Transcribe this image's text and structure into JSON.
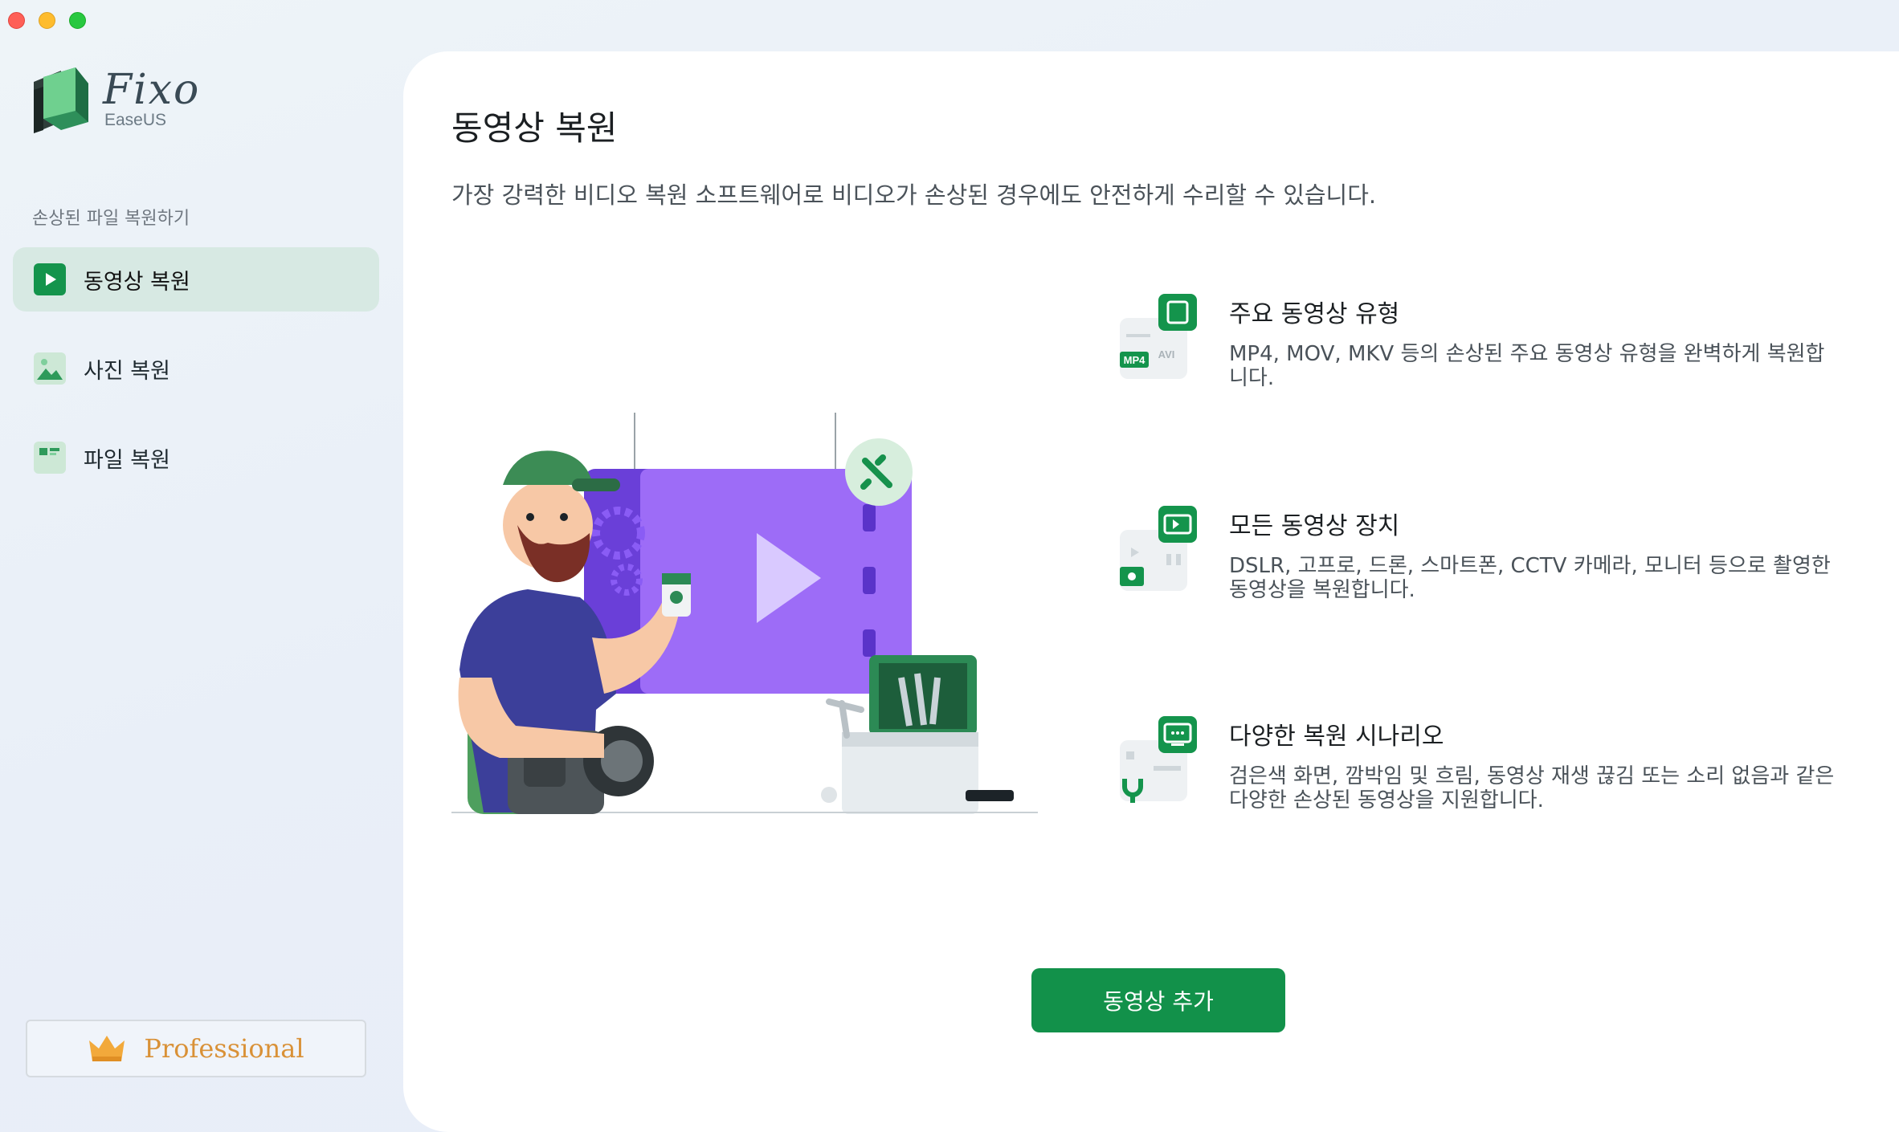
{
  "window": {
    "controls": [
      "close",
      "minimize",
      "zoom"
    ]
  },
  "sidebar": {
    "logo_title": "Fixo",
    "logo_subtitle": "EaseUS",
    "section_label": "손상된 파일 복원하기",
    "items": [
      {
        "label": "동영상 복원",
        "icon": "video-play-icon",
        "active": true
      },
      {
        "label": "사진 복원",
        "icon": "photo-icon",
        "active": false
      },
      {
        "label": "파일 복원",
        "icon": "file-icon",
        "active": false
      }
    ],
    "pro_button": {
      "label": "Professional",
      "icon": "crown-icon"
    }
  },
  "main": {
    "title": "동영상 복원",
    "description": "가장 강력한 비디오 복원 소프트웨어로 비디오가 손상된 경우에도 안전하게 수리할 수 있습니다.",
    "features": [
      {
        "title": "주요 동영상  유형",
        "description": "MP4, MOV, MKV 등의 손상된 주요 동영상  유형을 완벽하게 복원합니다.",
        "icon": "video-format-icon",
        "badges": [
          "MP4",
          "AVI"
        ]
      },
      {
        "title": "모든 동영상 장치",
        "description": "DSLR, 고프로, 드론, 스마트폰, CCTV 카메라, 모니터 등으로 촬영한 동영상을 복원합니다.",
        "icon": "video-device-icon"
      },
      {
        "title": "다양한 복원 시나리오",
        "description": "검은색 화면, 깜박임 및 흐림, 동영상 재생 끊김 또는 소리 없음과 같은 다양한 손상된 동영상을 지원합니다.",
        "icon": "repair-scenario-icon"
      }
    ],
    "add_button_label": "동영상 추가"
  },
  "colors": {
    "accent": "#12914a",
    "sidebar_active": "#d7e9e3",
    "pro_text": "#d99137",
    "illustration_purple": "#8a5cf5"
  }
}
